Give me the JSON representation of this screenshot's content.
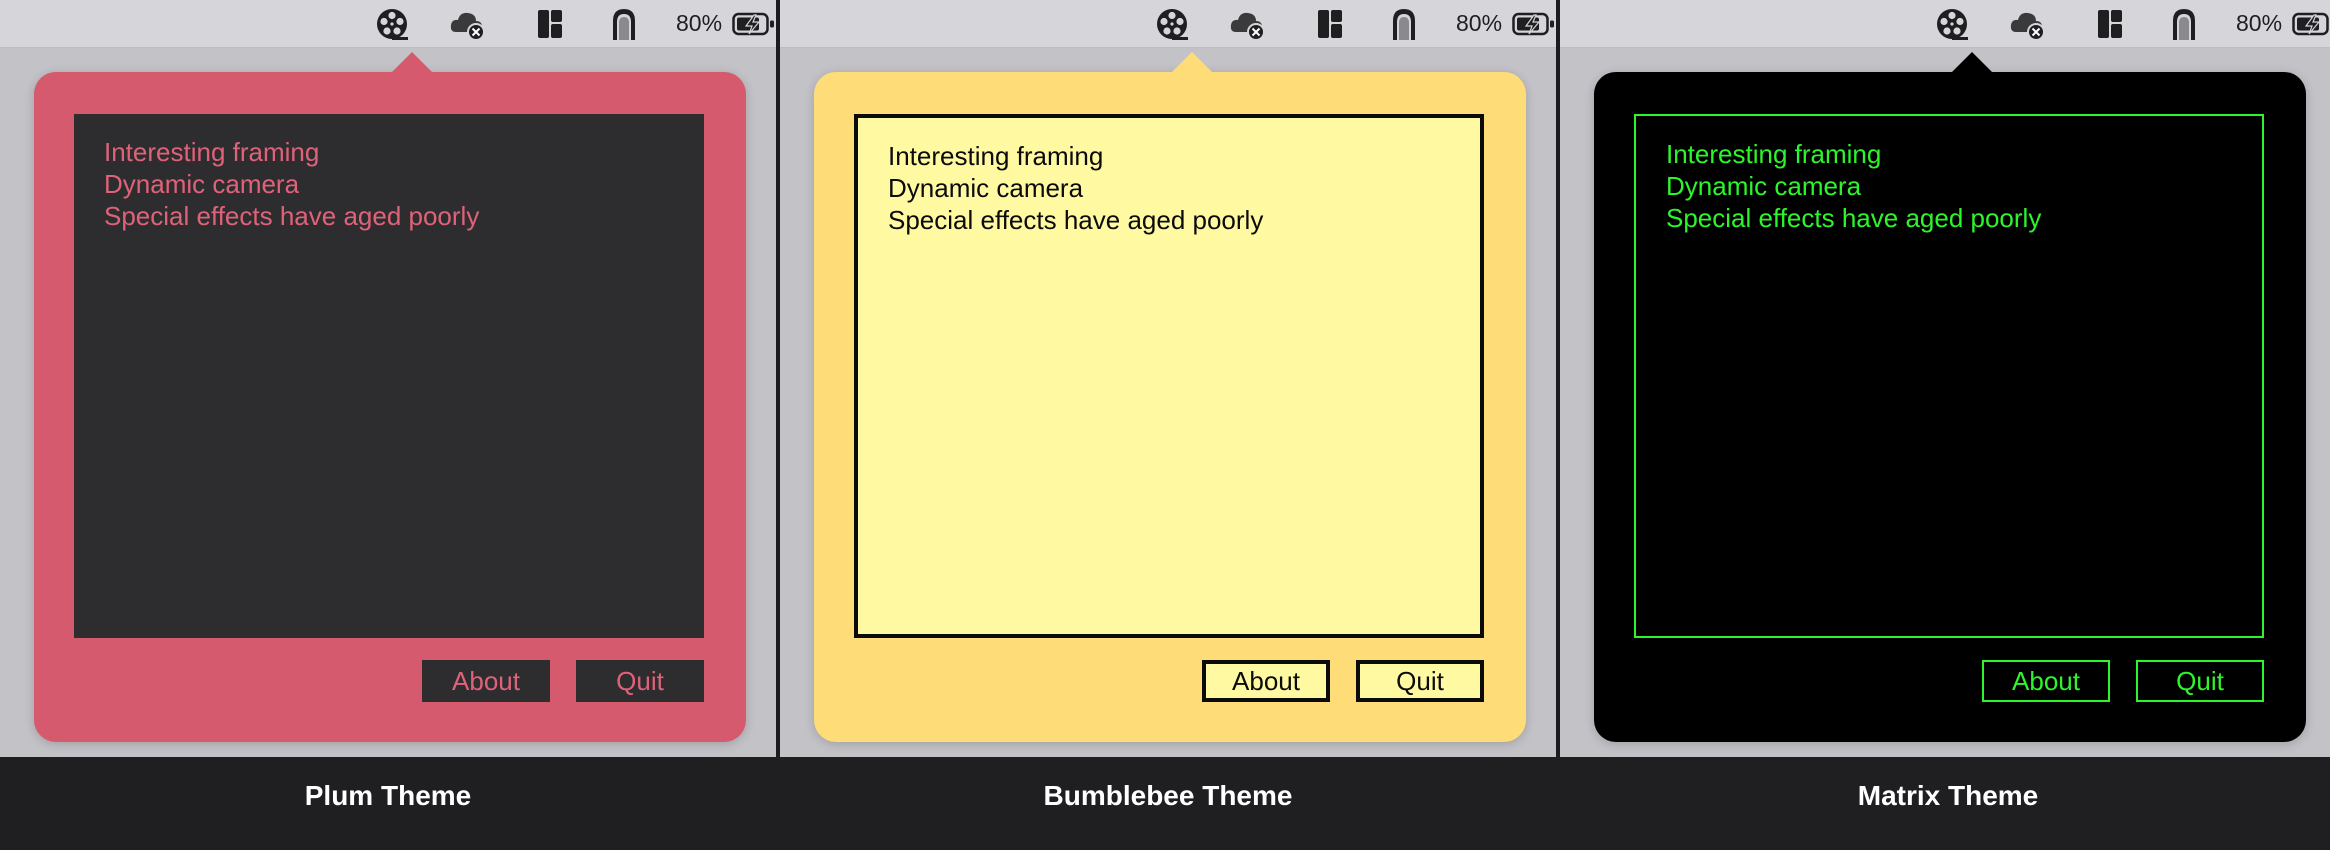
{
  "menubar": {
    "battery_percent": "80%",
    "icons": [
      "film-reel-icon",
      "cloud-error-icon",
      "layout-icon",
      "arch-icon",
      "battery-charging-icon"
    ]
  },
  "notes": {
    "lines": [
      "Interesting framing",
      "Dynamic camera",
      "Special effects have aged poorly"
    ]
  },
  "buttons": {
    "about": "About",
    "quit": "Quit"
  },
  "themes": [
    {
      "name": "Plum Theme",
      "frame_color": "#d65a6e",
      "content_bg": "#2d2d2f",
      "text_color": "#e0627a"
    },
    {
      "name": "Bumblebee Theme",
      "frame_color": "#fedc78",
      "content_bg": "#fffaa2",
      "text_color": "#0b0b0b"
    },
    {
      "name": "Matrix Theme",
      "frame_color": "#000000",
      "content_bg": "#000000",
      "text_color": "#2cf52c"
    }
  ]
}
